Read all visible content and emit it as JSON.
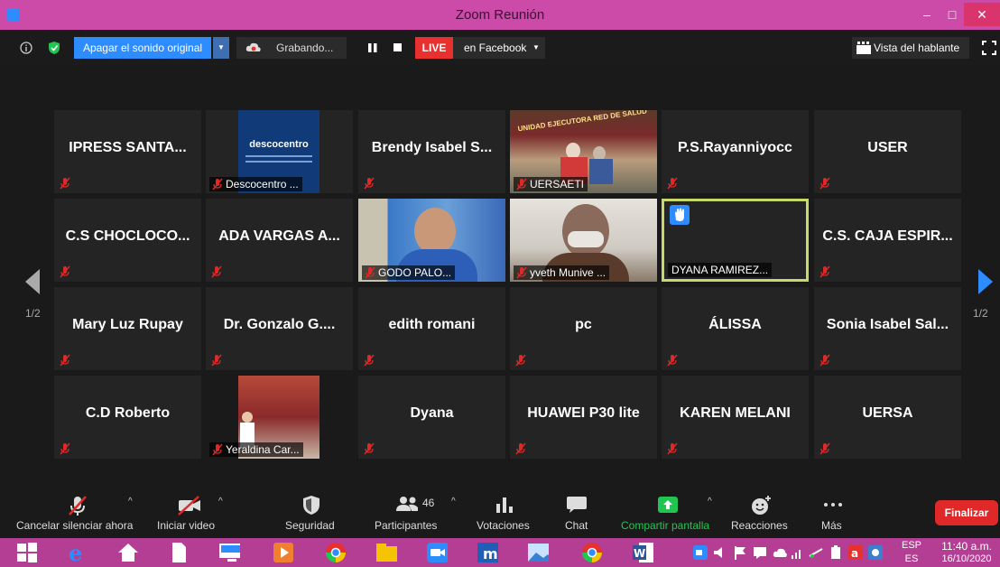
{
  "window": {
    "title": "Zoom Reunión",
    "minimize": "–",
    "maximize": "□",
    "close": "✕"
  },
  "topbar": {
    "mute_original": "Apagar el sonido original",
    "recording": "Grabando...",
    "live": "LIVE",
    "live_target": "en Facebook",
    "speaker_view": "Vista del hablante"
  },
  "gallery": {
    "page_left": "1/2",
    "page_right": "1/2",
    "tiles": [
      {
        "name": "IPRESS SANTA...",
        "type": "name"
      },
      {
        "name": "descocentro",
        "label": "Descocentro ...",
        "type": "logo"
      },
      {
        "name": "Brendy Isabel S...",
        "type": "name"
      },
      {
        "name": "UNIDAD EJECUTORA RED DE SALUD",
        "label": "UERSAETI",
        "type": "photo"
      },
      {
        "name": "P.S.Rayanniyocc",
        "type": "name"
      },
      {
        "name": "USER",
        "type": "name"
      },
      {
        "name": "C.S CHOCLOCO...",
        "type": "name"
      },
      {
        "name": "ADA VARGAS A...",
        "type": "name"
      },
      {
        "label": "GODO PALO...",
        "type": "video"
      },
      {
        "label": "yveth Munive ...",
        "type": "video"
      },
      {
        "label": "DYANA RAMIREZ...",
        "type": "active"
      },
      {
        "name": "C.S. CAJA ESPIR...",
        "type": "name"
      },
      {
        "name": "Mary Luz Rupay",
        "type": "name"
      },
      {
        "name": "Dr. Gonzalo G....",
        "type": "name"
      },
      {
        "name": "edith romani",
        "type": "name"
      },
      {
        "name": "pc",
        "type": "name"
      },
      {
        "name": "ÁLISSA",
        "type": "name"
      },
      {
        "name": "Sonia Isabel Sal...",
        "type": "name"
      },
      {
        "name": "C.D Roberto",
        "type": "name"
      },
      {
        "label": "Yeraldina Car...",
        "type": "video"
      },
      {
        "name": "Dyana",
        "type": "name"
      },
      {
        "name": "HUAWEI P30 lite",
        "type": "name"
      },
      {
        "name": "KAREN MELANI",
        "type": "name"
      },
      {
        "name": "UERSA",
        "type": "name"
      }
    ]
  },
  "bottombar": {
    "unmute": "Cancelar silenciar ahora",
    "start_video": "Iniciar video",
    "security": "Seguridad",
    "participants": "Participantes",
    "participants_count": "46",
    "polls": "Votaciones",
    "chat": "Chat",
    "share": "Compartir pantalla",
    "reactions": "Reacciones",
    "more": "Más",
    "end": "Finalizar"
  },
  "taskbar": {
    "lang1": "ESP",
    "lang2": "ES",
    "time": "11:40 a.m.",
    "date": "16/10/2020"
  },
  "colors": {
    "accent": "#2d8cff",
    "title_bar": "#cc4aa8",
    "taskbar": "#b33e93",
    "live": "#e8312f",
    "end": "#e02828",
    "share": "#23c552",
    "active_border": "#c8d86a"
  }
}
